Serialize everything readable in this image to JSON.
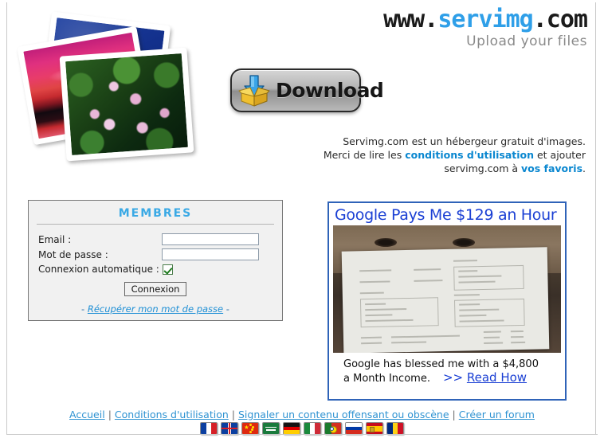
{
  "header": {
    "logo": {
      "prefix": "www.",
      "mid": "servimg",
      "suffix": ".com"
    },
    "tagline": "Upload your files"
  },
  "download": {
    "label": "Download",
    "icon": "download-box-icon"
  },
  "intro": {
    "line1": "Servimg.com est un hébergeur gratuit d'images.",
    "line2_a": "Merci de lire les ",
    "line2_link": "conditions d'utilisation",
    "line2_b": " et ajouter",
    "line3_a": "servimg.com à ",
    "line3_link": "vos favoris",
    "line3_b": "."
  },
  "members": {
    "title": "MEMBRES",
    "email_label": "Email :",
    "email_value": "",
    "password_label": "Mot de passe :",
    "password_value": "",
    "autologin_label": "Connexion automatique :",
    "autologin_checked": true,
    "submit_label": "Connexion",
    "recover_prefix": "-",
    "recover_label": "Récupérer mon mot de passe",
    "recover_suffix": "-"
  },
  "ad": {
    "headline": "Google Pays Me $129 an Hour",
    "caption_line1": "Google has blessed me with a $4,800",
    "caption_line2": "a Month Income.",
    "cta_arrows": ">>",
    "cta_label": "Read How",
    "border_color": "#2f63b8",
    "headline_color": "#1a3fd4"
  },
  "footer": {
    "links": [
      "Accueil",
      "Conditions d'utilisation",
      "Signaler un contenu offensant ou obscène",
      "Créer un forum"
    ],
    "separator": "|",
    "flags": [
      {
        "name": "flag-france",
        "title": "Français"
      },
      {
        "name": "flag-united-kingdom",
        "title": "English"
      },
      {
        "name": "flag-china",
        "title": "中文"
      },
      {
        "name": "flag-saudi-arabia",
        "title": "العربية"
      },
      {
        "name": "flag-germany",
        "title": "Deutsch"
      },
      {
        "name": "flag-italy",
        "title": "Italiano"
      },
      {
        "name": "flag-portugal",
        "title": "Português"
      },
      {
        "name": "flag-russia",
        "title": "Русский"
      },
      {
        "name": "flag-spain",
        "title": "Español"
      },
      {
        "name": "flag-romania",
        "title": "Română"
      }
    ]
  },
  "photos": [
    {
      "name": "photo-blue",
      "subject": "blue abstract photo"
    },
    {
      "name": "photo-sunset",
      "subject": "pink red sunset photo"
    },
    {
      "name": "photo-lilies",
      "subject": "water lilies photo"
    }
  ]
}
